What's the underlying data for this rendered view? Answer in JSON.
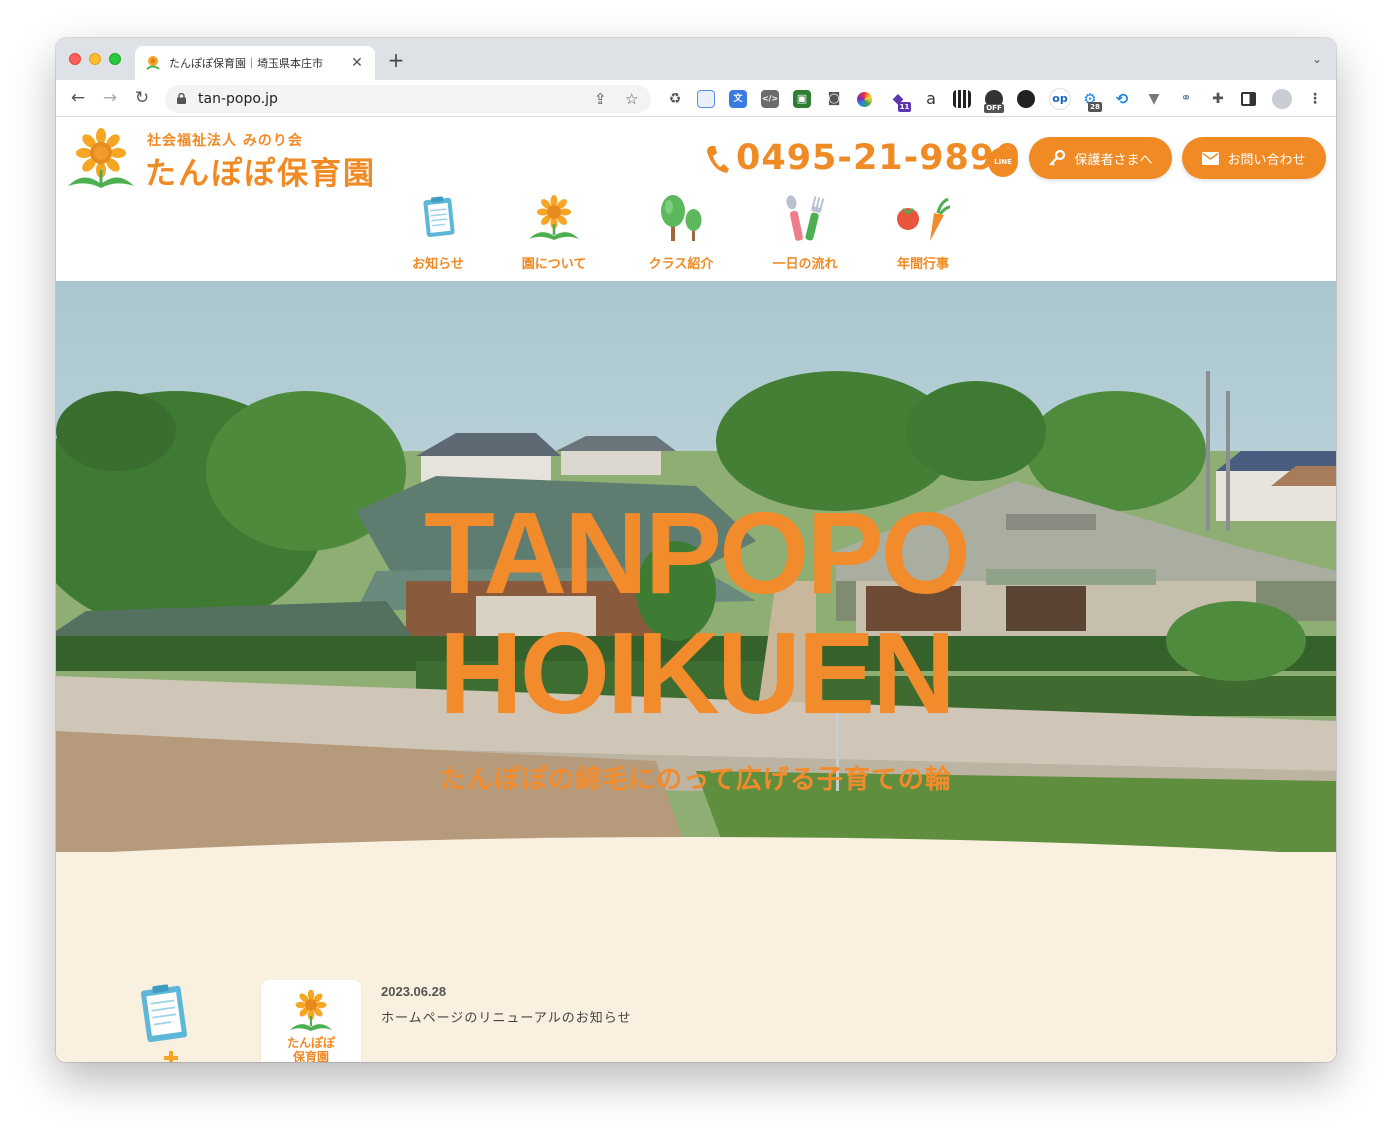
{
  "browser": {
    "tab_title": "たんぽぽ保育園｜埼玉県本庄市",
    "url": "tan-popo.jp",
    "extension_icons": [
      "recycle-icon",
      "note-icon",
      "translate-icon",
      "code-icon",
      "robot-icon",
      "camera-icon",
      "color-wheel-icon",
      "graduation-cap-icon",
      "amazon-icon",
      "qr-code-icon",
      "speed-icon",
      "yinyang-icon",
      "op-icon",
      "gear-icon",
      "history-icon",
      "vector-icon",
      "link-icon",
      "puzzle-icon",
      "sidebar-icon",
      "profile-icon"
    ],
    "badges": {
      "cap": "11",
      "gear": "28",
      "speed": "OFF"
    },
    "ext_labels": {
      "amazon": "a",
      "op": "op"
    }
  },
  "header": {
    "org_name": "社会福祉法人 みのり会",
    "site_name": "たんぽぽ保育園",
    "phone": "0495-21-9890",
    "line_label": "LINE",
    "parent_button": "保護者さまへ",
    "contact_button": "お問い合わせ"
  },
  "nav": {
    "items": [
      {
        "label": "お知らせ",
        "icon": "clipboard-icon"
      },
      {
        "label": "園について",
        "icon": "sunflower-icon"
      },
      {
        "label": "クラス紹介",
        "icon": "trees-icon"
      },
      {
        "label": "一日の流れ",
        "icon": "cutlery-icon"
      },
      {
        "label": "年間行事",
        "icon": "vegetables-icon"
      }
    ]
  },
  "hero": {
    "title_line1": "TANPOPO",
    "title_line2": "HOIKUEN",
    "subtitle": "たんぽぽの綿毛にのって広げる子育ての輪"
  },
  "news": {
    "card_name_line1": "たんぽぽ",
    "card_name_line2": "保育園",
    "date": "2023.06.28",
    "title": "ホームページのリニューアルのお知らせ"
  },
  "colors": {
    "accent": "#f08a24",
    "cream": "#faf0e0"
  }
}
